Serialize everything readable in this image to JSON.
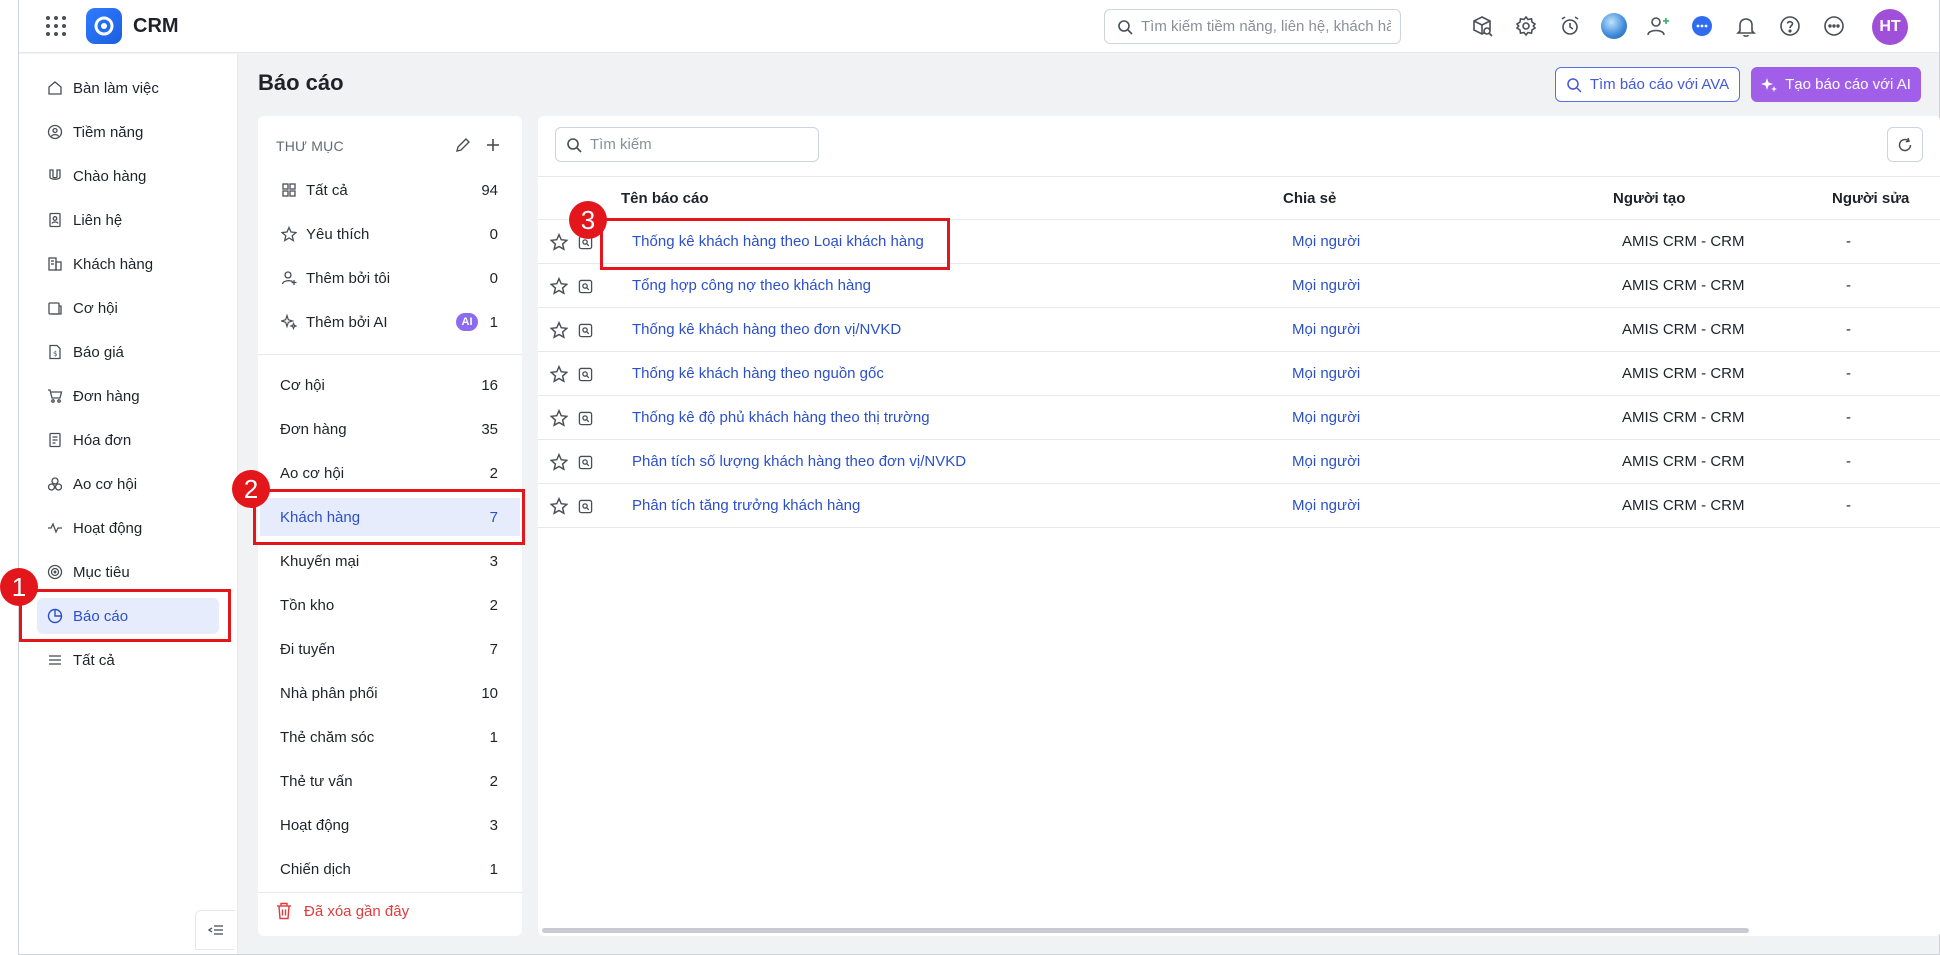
{
  "app": {
    "name": "CRM"
  },
  "header": {
    "search_placeholder": "Tìm kiếm tiềm năng, liên hệ, khách hàng",
    "avatar_initials": "HT",
    "icons": [
      "box-search-icon",
      "gear-icon",
      "alarm-clock-icon",
      "profile-avatar",
      "add-user-icon",
      "chat-icon",
      "bell-icon",
      "help-icon",
      "more-icon"
    ]
  },
  "sidebar": {
    "items": [
      {
        "label": "Bàn làm việc",
        "icon": "home-icon"
      },
      {
        "label": "Tiềm năng",
        "icon": "prospect-icon"
      },
      {
        "label": "Chào hàng",
        "icon": "magnet-icon"
      },
      {
        "label": "Liên hệ",
        "icon": "contact-icon"
      },
      {
        "label": "Khách hàng",
        "icon": "building-icon"
      },
      {
        "label": "Cơ hội",
        "icon": "opportunity-icon"
      },
      {
        "label": "Báo giá",
        "icon": "quote-icon"
      },
      {
        "label": "Đơn hàng",
        "icon": "cart-icon"
      },
      {
        "label": "Hóa đơn",
        "icon": "invoice-icon"
      },
      {
        "label": "Ao cơ hội",
        "icon": "pool-icon"
      },
      {
        "label": "Hoạt động",
        "icon": "activity-icon"
      },
      {
        "label": "Mục tiêu",
        "icon": "target-icon"
      },
      {
        "label": "Báo cáo",
        "icon": "report-icon",
        "active": true
      },
      {
        "label": "Tất cả",
        "icon": "menu-icon"
      }
    ]
  },
  "page": {
    "title": "Báo cáo",
    "ava_button": "Tìm báo cáo với AVA",
    "ai_button": "Tạo báo cáo với AI"
  },
  "folders": {
    "header": "THƯ MỤC",
    "pinned": [
      {
        "label": "Tất cả",
        "count": "94",
        "icon": "grid-icon"
      },
      {
        "label": "Yêu thích",
        "count": "0",
        "icon": "star-icon"
      },
      {
        "label": "Thêm bởi tôi",
        "count": "0",
        "icon": "user-plus-icon"
      },
      {
        "label": "Thêm bởi AI",
        "count": "1",
        "icon": "sparkle-icon",
        "badge": "AI"
      }
    ],
    "items": [
      {
        "label": "Cơ hội",
        "count": "16"
      },
      {
        "label": "Đơn hàng",
        "count": "35"
      },
      {
        "label": "Ao cơ hội",
        "count": "2"
      },
      {
        "label": "Khách hàng",
        "count": "7",
        "active": true
      },
      {
        "label": "Khuyến mại",
        "count": "3"
      },
      {
        "label": "Tồn kho",
        "count": "2"
      },
      {
        "label": "Đi tuyến",
        "count": "7"
      },
      {
        "label": "Nhà phân phối",
        "count": "10"
      },
      {
        "label": "Thẻ chăm sóc",
        "count": "1"
      },
      {
        "label": "Thẻ tư vấn",
        "count": "2"
      },
      {
        "label": "Hoạt động",
        "count": "3"
      },
      {
        "label": "Chiến dịch",
        "count": "1"
      }
    ],
    "deleted_label": "Đã xóa gần đây"
  },
  "reports": {
    "search_placeholder": "Tìm kiếm",
    "columns": {
      "name": "Tên báo cáo",
      "share": "Chia sẻ",
      "creator": "Người tạo",
      "editor": "Người sửa"
    },
    "rows": [
      {
        "name": "Thống kê khách hàng theo Loại khách hàng",
        "share": "Mọi người",
        "creator": "AMIS CRM - CRM",
        "editor": "-"
      },
      {
        "name": "Tổng hợp công nợ theo khách hàng",
        "share": "Mọi người",
        "creator": "AMIS CRM - CRM",
        "editor": "-"
      },
      {
        "name": "Thống kê khách hàng theo đơn vị/NVKD",
        "share": "Mọi người",
        "creator": "AMIS CRM - CRM",
        "editor": "-"
      },
      {
        "name": "Thống kê khách hàng theo nguồn gốc",
        "share": "Mọi người",
        "creator": "AMIS CRM - CRM",
        "editor": "-"
      },
      {
        "name": "Thống kê độ phủ khách hàng theo thị trường",
        "share": "Mọi người",
        "creator": "AMIS CRM - CRM",
        "editor": "-"
      },
      {
        "name": "Phân tích số lượng khách hàng theo đơn vị/NVKD",
        "share": "Mọi người",
        "creator": "AMIS CRM - CRM",
        "editor": "-"
      },
      {
        "name": "Phân tích tăng trưởng khách hàng",
        "share": "Mọi người",
        "creator": "AMIS CRM - CRM",
        "editor": "-"
      }
    ]
  },
  "annotations": {
    "step1": "1",
    "step2": "2",
    "step3": "3",
    "color": "#e3161c"
  }
}
